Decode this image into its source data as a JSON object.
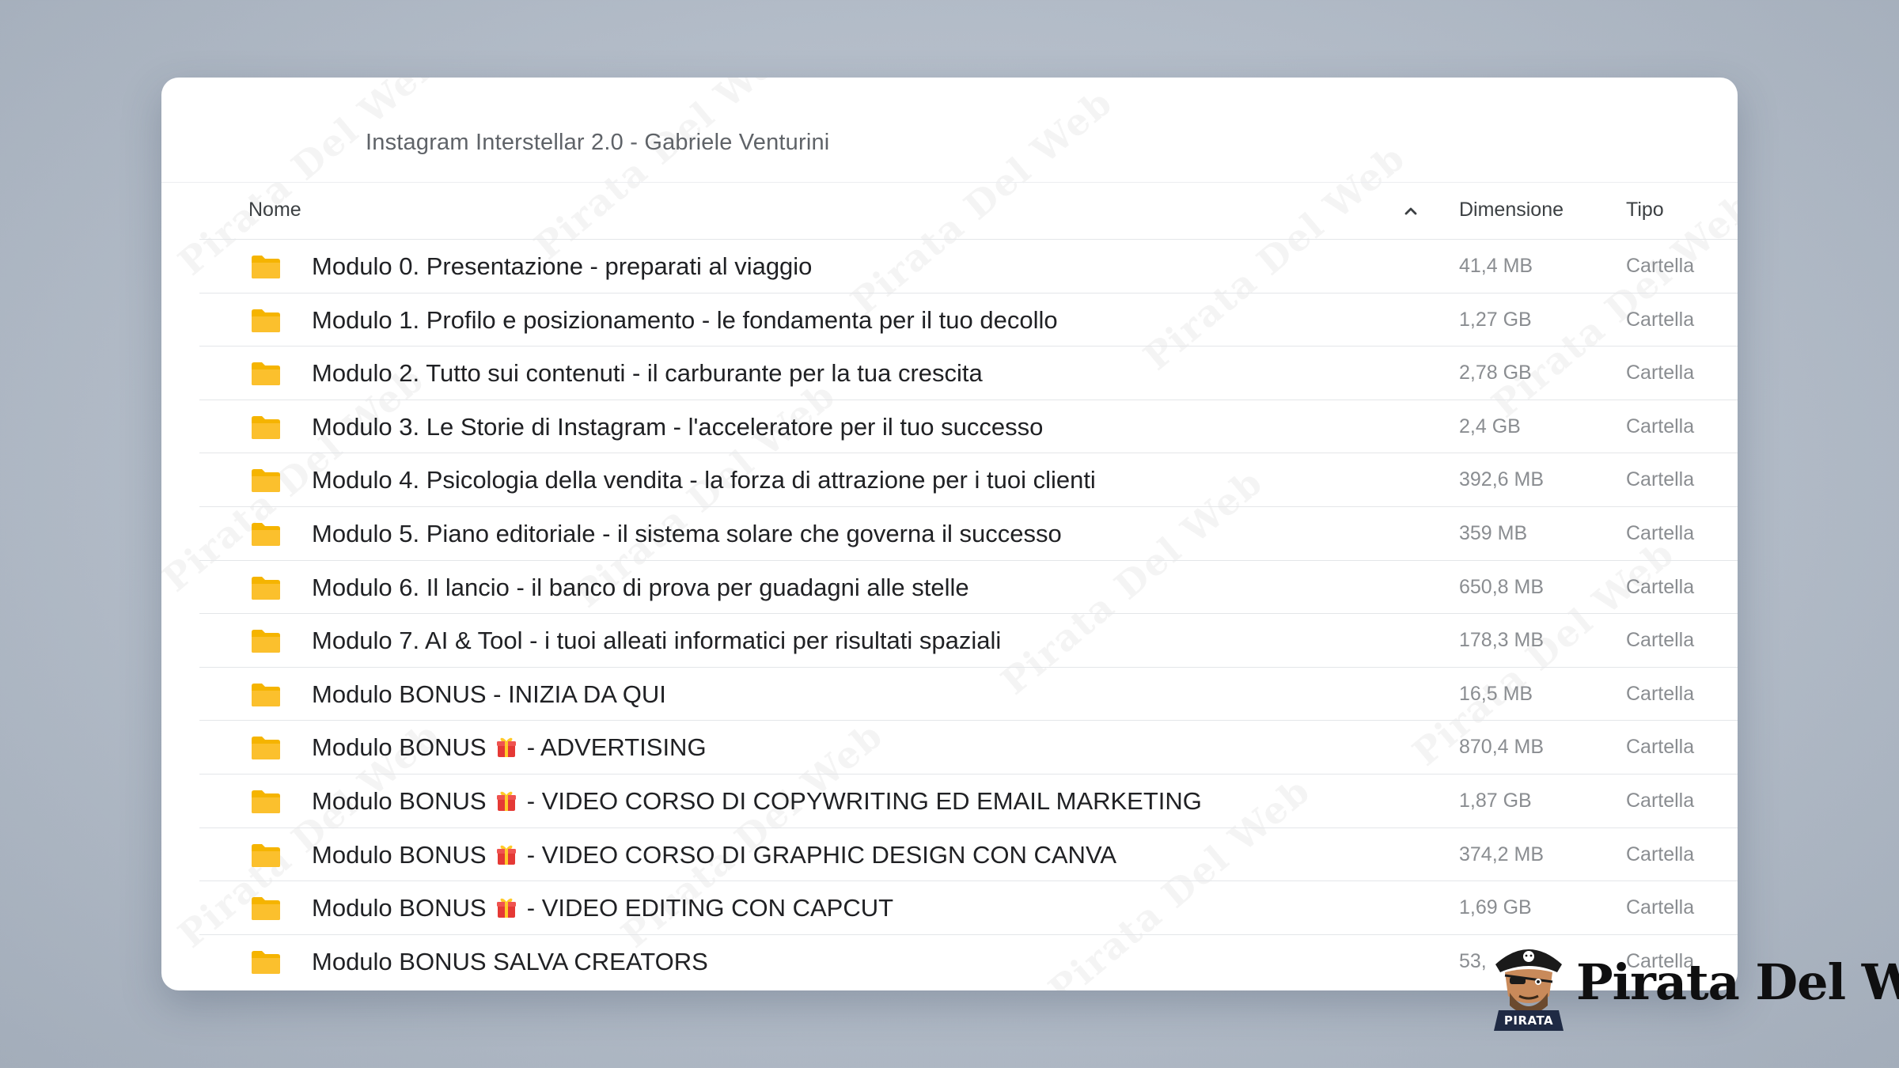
{
  "window": {
    "path_title": "Instagram Interstellar 2.0 - Gabriele Venturini"
  },
  "table": {
    "headers": {
      "name": "Nome",
      "size": "Dimensione",
      "type": "Tipo"
    },
    "sort_icon": "chevron-up-icon",
    "rows": [
      {
        "pre": "Modulo 0. Presentazione - preparati al viaggio",
        "gift": false,
        "post": "",
        "size": "41,4 MB",
        "type": "Cartella"
      },
      {
        "pre": "Modulo 1. Profilo e posizionamento - le fondamenta per il tuo decollo",
        "gift": false,
        "post": "",
        "size": "1,27 GB",
        "type": "Cartella"
      },
      {
        "pre": "Modulo 2. Tutto sui contenuti - il carburante per la tua crescita",
        "gift": false,
        "post": "",
        "size": "2,78 GB",
        "type": "Cartella"
      },
      {
        "pre": "Modulo 3. Le Storie di Instagram - l'acceleratore per il tuo successo",
        "gift": false,
        "post": "",
        "size": "2,4 GB",
        "type": "Cartella"
      },
      {
        "pre": "Modulo 4. Psicologia della vendita - la forza di attrazione per i tuoi clienti",
        "gift": false,
        "post": "",
        "size": "392,6 MB",
        "type": "Cartella"
      },
      {
        "pre": "Modulo 5. Piano editoriale - il sistema solare che governa il successo",
        "gift": false,
        "post": "",
        "size": "359 MB",
        "type": "Cartella"
      },
      {
        "pre": "Modulo 6. Il lancio - il banco di prova per guadagni alle stelle",
        "gift": false,
        "post": "",
        "size": "650,8 MB",
        "type": "Cartella"
      },
      {
        "pre": "Modulo 7. AI & Tool - i tuoi alleati informatici per risultati spaziali",
        "gift": false,
        "post": "",
        "size": "178,3 MB",
        "type": "Cartella"
      },
      {
        "pre": "Modulo BONUS - INIZIA DA QUI",
        "gift": false,
        "post": "",
        "size": "16,5 MB",
        "type": "Cartella"
      },
      {
        "pre": "Modulo BONUS ",
        "gift": true,
        "post": " - ADVERTISING",
        "size": "870,4 MB",
        "type": "Cartella"
      },
      {
        "pre": "Modulo BONUS ",
        "gift": true,
        "post": " - VIDEO CORSO DI COPYWRITING ED EMAIL MARKETING",
        "size": "1,87 GB",
        "type": "Cartella"
      },
      {
        "pre": "Modulo BONUS ",
        "gift": true,
        "post": " - VIDEO CORSO DI GRAPHIC DESIGN CON CANVA",
        "size": "374,2 MB",
        "type": "Cartella"
      },
      {
        "pre": "Modulo BONUS ",
        "gift": true,
        "post": " - VIDEO EDITING CON CAPCUT",
        "size": "1,69 GB",
        "type": "Cartella"
      },
      {
        "pre": "Modulo BONUS SALVA CREATORS",
        "gift": false,
        "post": "",
        "size": "53,",
        "type": "Cartella"
      }
    ]
  },
  "watermark": {
    "text": "Pirata Del Web",
    "color": "#969696"
  },
  "logo": {
    "name": "Pirata Del Web",
    "badge": "PIRATA"
  },
  "colors": {
    "folder": "#f5b400",
    "gift": "#e53935",
    "text_primary": "#202124",
    "text_secondary": "#8a8d91"
  }
}
